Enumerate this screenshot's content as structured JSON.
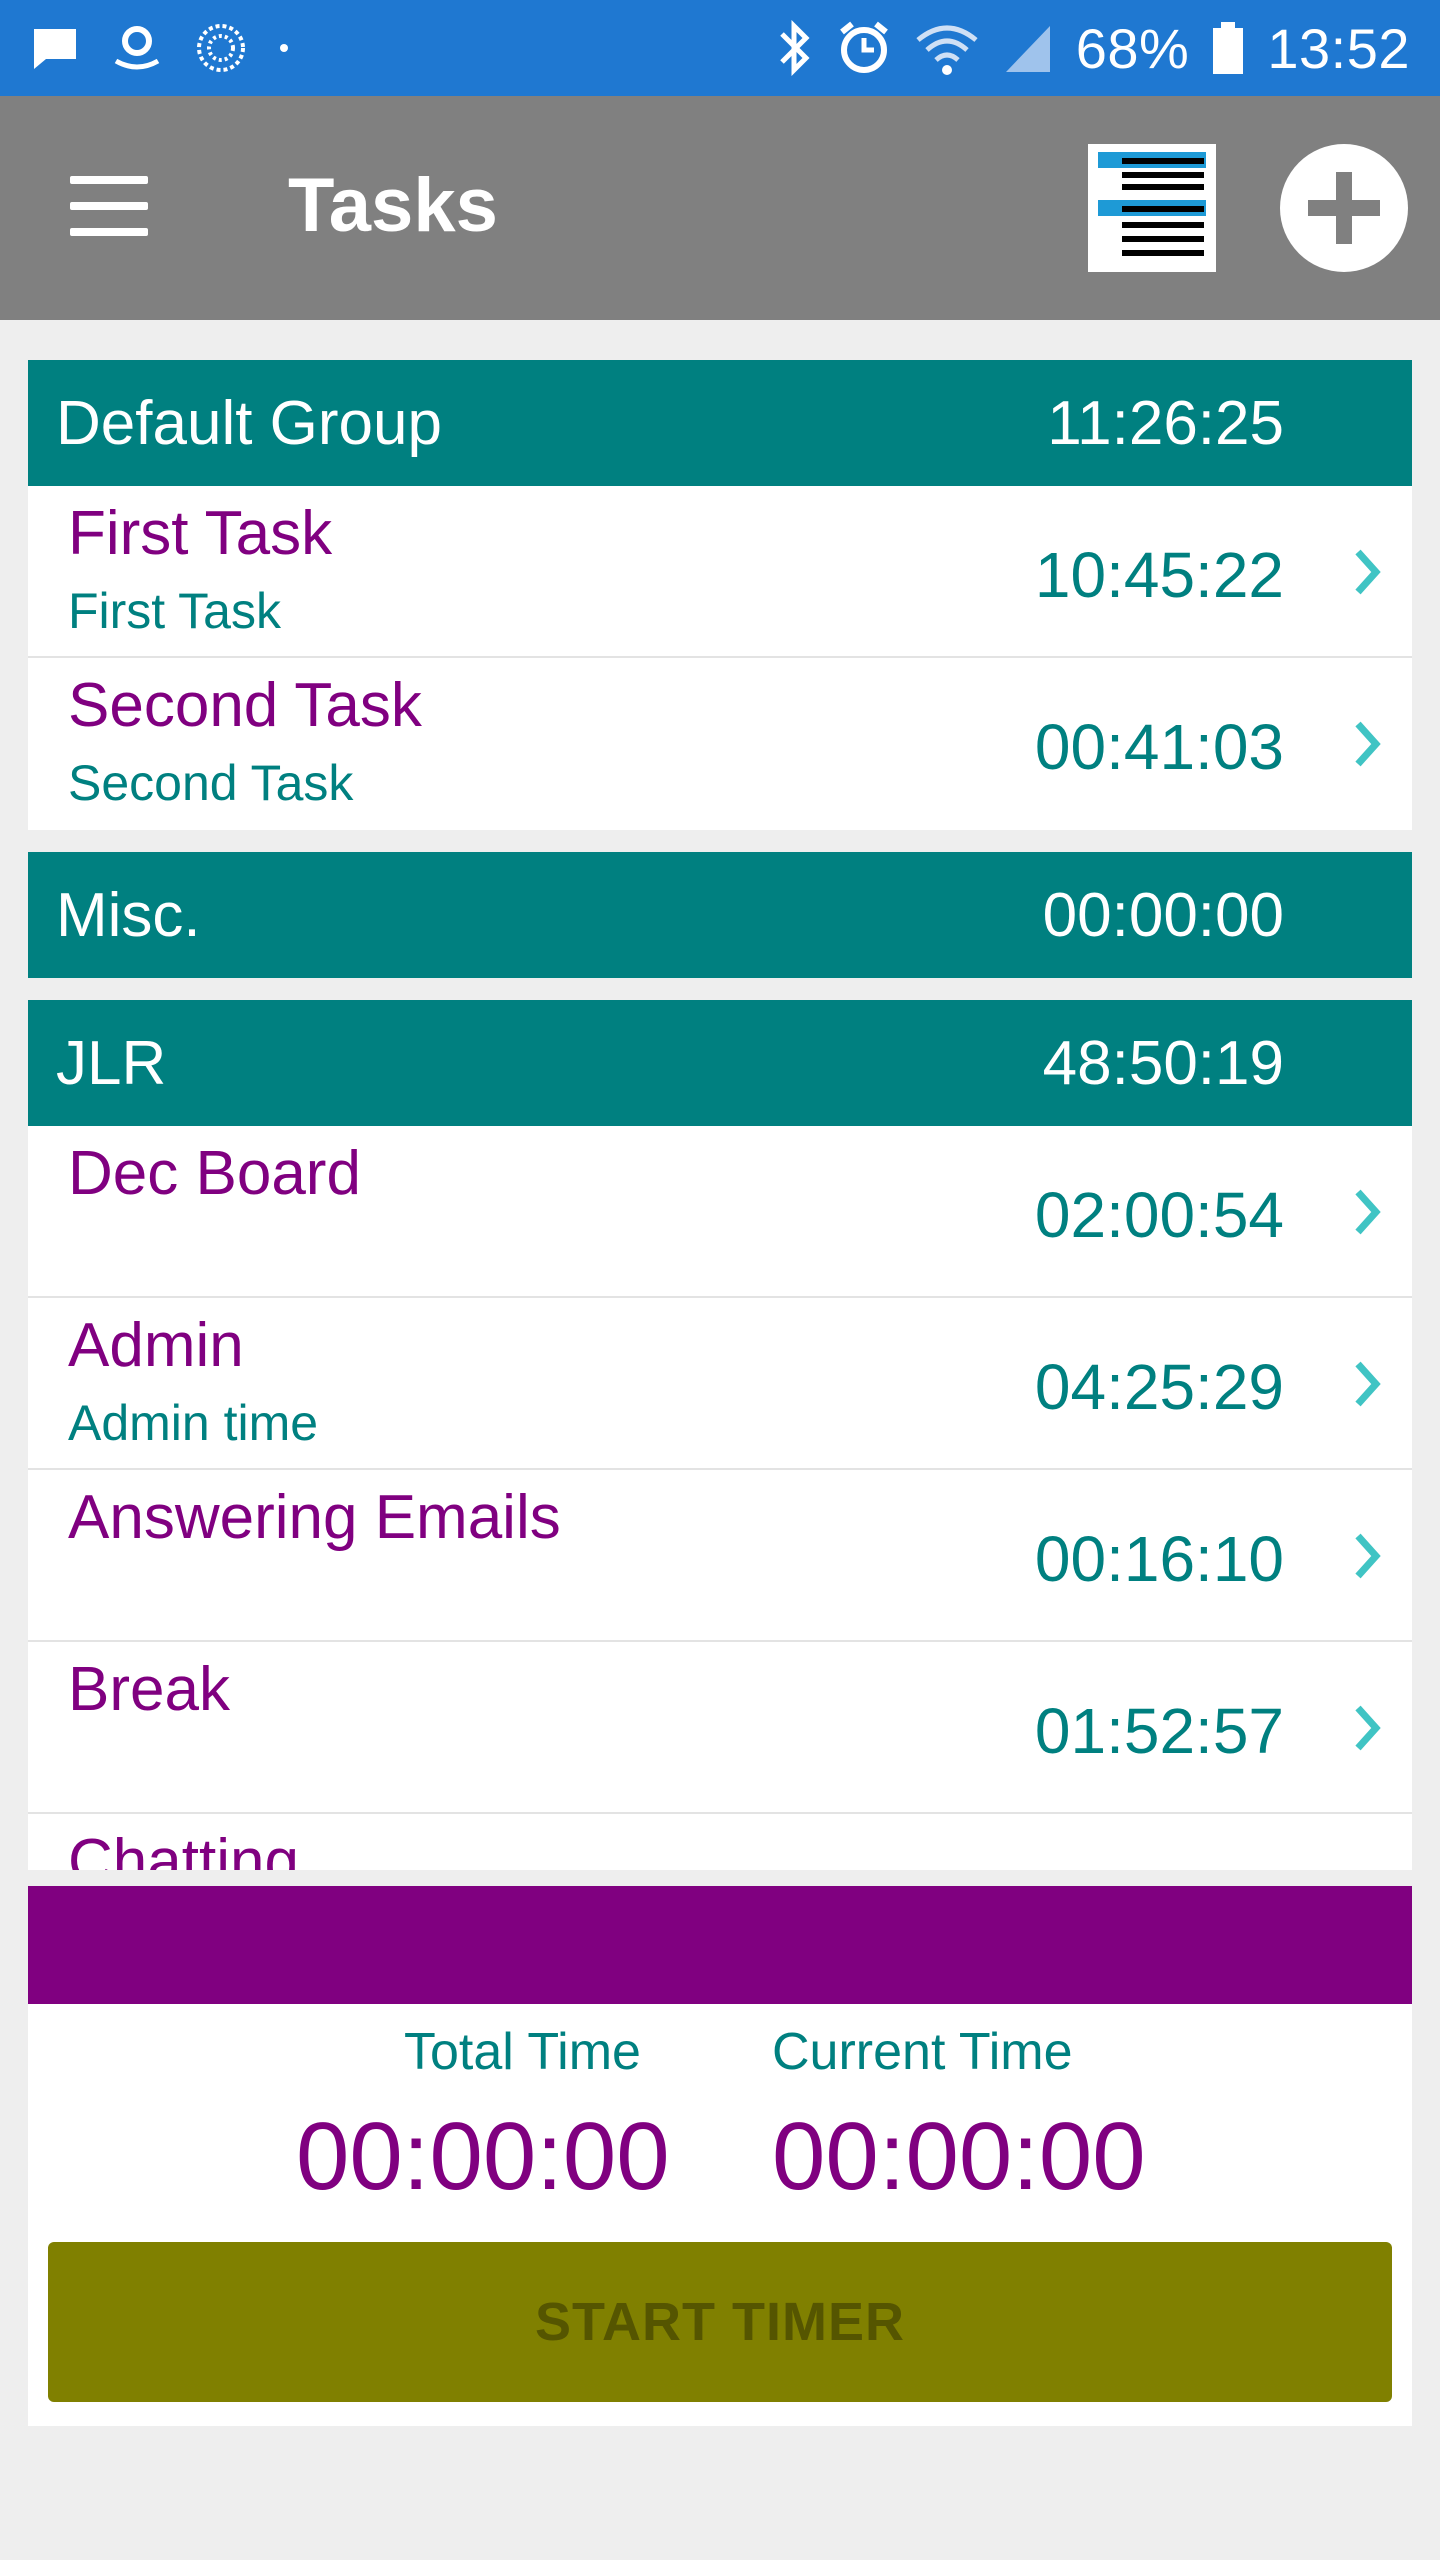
{
  "status_bar": {
    "battery": "68%",
    "time": "13:52",
    "icons_left": [
      "message-icon",
      "amazon-icon",
      "sync-icon",
      "dot-icon"
    ],
    "icons_right": [
      "bluetooth-icon",
      "alarm-icon",
      "wifi-icon",
      "signal-icon",
      "battery-icon"
    ]
  },
  "app_bar": {
    "title": "Tasks",
    "menu_icon": "hamburger-menu-icon",
    "list_icon": "list-view-icon",
    "add_icon": "add-circle-icon"
  },
  "groups": [
    {
      "name": "Default Group",
      "time": "11:26:25",
      "tasks": [
        {
          "name": "First Task",
          "description": "First Task",
          "time": "10:45:22"
        },
        {
          "name": "Second Task",
          "description": "Second Task",
          "time": "00:41:03"
        }
      ]
    },
    {
      "name": "Misc.",
      "time": "00:00:00",
      "tasks": []
    },
    {
      "name": "JLR",
      "time": "48:50:19",
      "tasks": [
        {
          "name": "Dec Board",
          "description": "",
          "time": "02:00:54"
        },
        {
          "name": "Admin",
          "description": "Admin time",
          "time": "04:25:29"
        },
        {
          "name": "Answering Emails",
          "description": "",
          "time": "00:16:10"
        },
        {
          "name": "Break",
          "description": "",
          "time": "01:52:57"
        },
        {
          "name": "Chatting",
          "description": "",
          "time": ""
        }
      ]
    }
  ],
  "timer": {
    "total_label": "Total Time",
    "total_value": "00:00:00",
    "current_label": "Current Time",
    "current_value": "00:00:00",
    "start_button": "START TIMER"
  },
  "colors": {
    "status_bar": "#1f78d1",
    "app_bar": "#808080",
    "group_header": "#008080",
    "task_name": "#800080",
    "accent_bar": "#800080",
    "start_button": "#808000",
    "chevron": "#40c4c4"
  }
}
